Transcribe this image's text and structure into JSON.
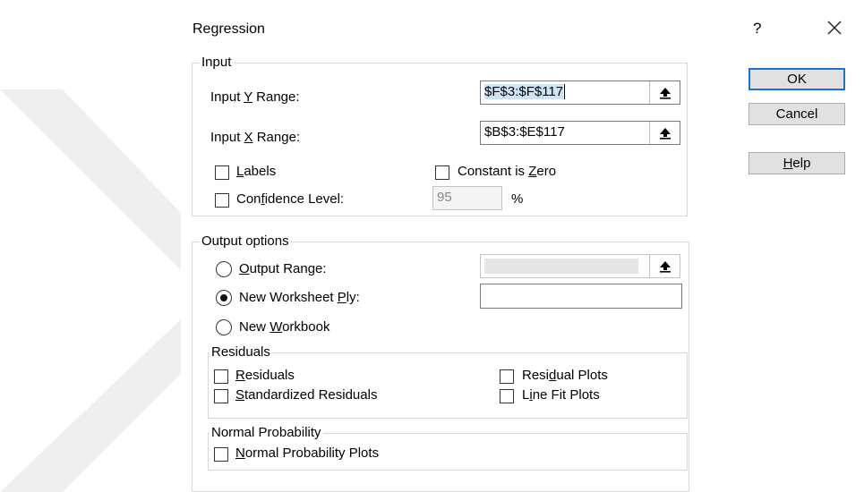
{
  "dialog": {
    "title": "Regression",
    "help_glyph": "?",
    "close_icon": "close-icon"
  },
  "buttons": {
    "ok": "OK",
    "cancel": "Cancel",
    "help": "Help",
    "help_hotkey": "H",
    "help_rest": "elp"
  },
  "input": {
    "group_label": "Input",
    "y_range_label_pre": "Input ",
    "y_range_label_key": "Y",
    "y_range_label_post": " Range:",
    "y_range_value": "$F$3:$F$117",
    "x_range_label_pre": "Input ",
    "x_range_label_key": "X",
    "x_range_label_post": " Range:",
    "x_range_value": "$B$3:$E$117",
    "labels_key": "L",
    "labels_rest": "abels",
    "labels_checked": false,
    "constant_pre": "Constant is ",
    "constant_key": "Z",
    "constant_rest": "ero",
    "constant_checked": false,
    "confidence_pre": "Con",
    "confidence_key": "f",
    "confidence_rest": "idence Level:",
    "confidence_checked": false,
    "confidence_value": "95",
    "percent": "%"
  },
  "output": {
    "group_label": "Output options",
    "output_range_key": "O",
    "output_range_rest": "utput Range:",
    "output_range_value": "",
    "new_ply_pre": "New Worksheet ",
    "new_ply_key": "P",
    "new_ply_rest": "ly:",
    "new_ply_value": "",
    "new_workbook_pre": "New ",
    "new_workbook_key": "W",
    "new_workbook_rest": "orkbook",
    "selected": "new_worksheet_ply"
  },
  "residuals": {
    "group_label": "Residuals",
    "residuals_key": "R",
    "residuals_rest": "esiduals",
    "standardized_key": "S",
    "standardized_rest": "tandardized Residuals",
    "residual_plots_pre": "Resi",
    "residual_plots_key": "d",
    "residual_plots_rest": "ual Plots",
    "line_fit_key": "L",
    "line_fit_pre": "",
    "line_fit_rest": "ine Fit Plots",
    "line_fit_plain_first": "L",
    "line_fit_underlined": "i",
    "line_fit_after": "ne Fit Plots"
  },
  "normal_probability": {
    "group_label": "Normal Probability",
    "plots_key": "N",
    "plots_rest": "ormal Probability Plots"
  },
  "icons": {
    "range_button": "collapse-range-arrow-icon",
    "watermark": "chevron-watermark-icon"
  }
}
